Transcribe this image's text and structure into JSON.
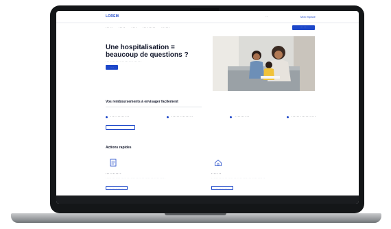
{
  "header": {
    "logo": "LOREM",
    "search": "···",
    "account_link": "Mon espace"
  },
  "nav": {
    "items": [
      "· · · · ·",
      "· · · · ·",
      "· · · ·",
      "· · · · · · · · ·",
      "· · · · · ·"
    ],
    "cta": "· · · · · ·"
  },
  "hero": {
    "title": "Une hospitalisation = beaucoup de questions ?",
    "subtitle": "· · · · · · · · · · · · · · · · · · · · · · · · ·",
    "button": "· · · ·"
  },
  "steps_section": {
    "title": "Vos remboursements à envisager facilement",
    "steps": [
      "· · · · · · · · · · · · ·",
      "· · · · · · · · · · · · · · ·",
      "· · · · · · · · · ·",
      "· · · · · · · · · · · · · · · · ·"
    ],
    "button": "· · · · · · · · · · ·"
  },
  "quick_actions": {
    "title": "Actions rapides",
    "cards": [
      {
        "icon": "document-icon",
        "title": "· · · · · · · · · · ·",
        "text": "· · · · · · · · · · · · · · · · · · · · · · · · · · · · · · · · · · · · · · · · · · · · · · · ·",
        "button": "· · · · · · · · · ·"
      },
      {
        "icon": "house-icon",
        "title": "· · · · · · ·",
        "text": "· · · · · · · · · · · · · · · · · · · · · · · · · · · · · · · · · · · · · · · · · · ·",
        "button": "· · · · · · · · · ·"
      }
    ]
  },
  "colors": {
    "primary": "#1d47c9",
    "frame": "#141618",
    "heading": "#12172b"
  }
}
